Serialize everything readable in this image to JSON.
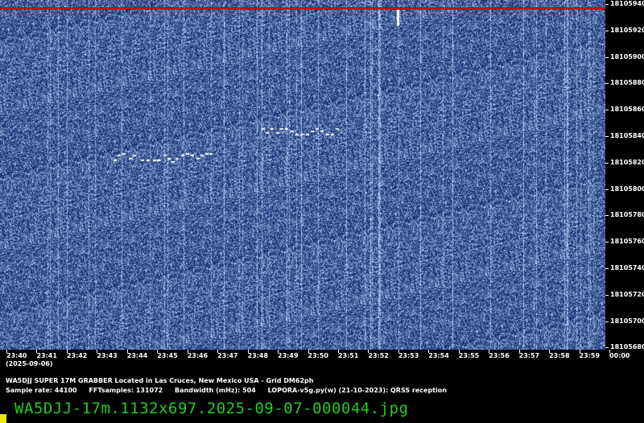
{
  "colors": {
    "background": "#000000",
    "waterfall": "#10307a",
    "signal": "#ffffff",
    "redline": "#d40000",
    "filename": "#22cc22",
    "corner": "#e8e800"
  },
  "y_axis": [
    "18105940",
    "18105920",
    "18105900",
    "18105880",
    "18105860",
    "18105840",
    "18105820",
    "18105800",
    "18105780",
    "18105760",
    "18105740",
    "18105720",
    "18105700",
    "18105680"
  ],
  "x_axis": [
    "23:40",
    "23:41",
    "23:42",
    "23:43",
    "23:44",
    "23:45",
    "23:46",
    "23:47",
    "23:48",
    "23:49",
    "23:50",
    "23:51",
    "23:52",
    "23:53",
    "23:54",
    "23:55",
    "23:56",
    "23:57",
    "23:58",
    "23:59",
    "00:00"
  ],
  "date": "(2025-09-06)",
  "info": {
    "line1": "WA5DJJ SUPER 17M GRABBER Located in Las Cruces, New Mexico USA - Grid DM62ph",
    "sample_rate": "Sample rate: 44100",
    "fft": "FFTsamples: 131072",
    "bandwidth": "Bandwidth (mHz): 504",
    "version": "LOPORA-v5g.py(w) (21-10-2023): QRSS reception"
  },
  "filename": "WA5DJJ-17m.1132x697.2025-09-07-000044.jpg"
}
